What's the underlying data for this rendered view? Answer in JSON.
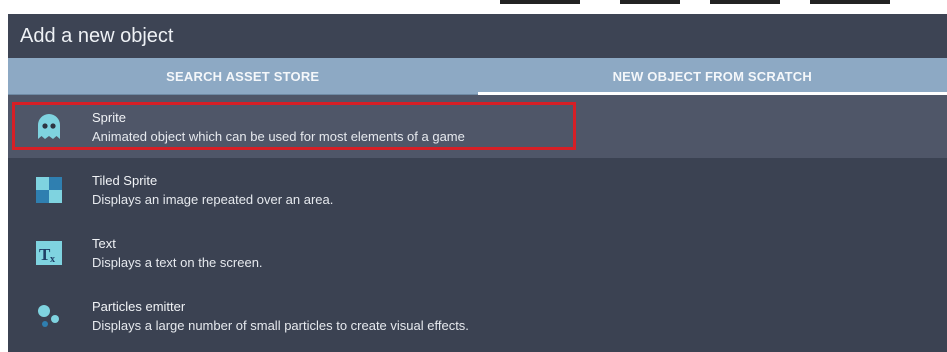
{
  "dialog": {
    "title": "Add a new object",
    "tabs": [
      {
        "label": "SEARCH ASSET STORE"
      },
      {
        "label": "NEW OBJECT FROM SCRATCH"
      }
    ],
    "items": [
      {
        "icon": "ghost-sprite-icon",
        "name": "Sprite",
        "description": "Animated object which can be used for most elements of a game"
      },
      {
        "icon": "tiled-sprite-icon",
        "name": "Tiled Sprite",
        "description": "Displays an image repeated over an area."
      },
      {
        "icon": "text-object-icon",
        "name": "Text",
        "description": "Displays a text on the screen."
      },
      {
        "icon": "particles-icon",
        "name": "Particles emitter",
        "description": "Displays a large number of small particles to create visual effects."
      }
    ]
  },
  "colors": {
    "dialog_bg": "#3b4252",
    "tab_bar": "#8da9c4",
    "selection_border": "#d61f26",
    "icon_teal": "#7fd3e0"
  }
}
